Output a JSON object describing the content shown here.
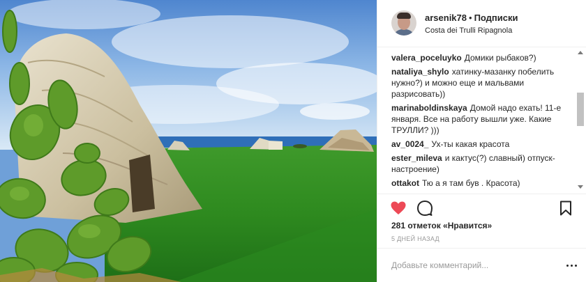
{
  "header": {
    "username": "arsenik78",
    "separator": "•",
    "follow_state": "Подписки",
    "location": "Costa dei Trulli Ripagnola",
    "avatar_icon": "user-avatar-icon"
  },
  "comments": [
    {
      "user": "valera_poceluyko",
      "text": "Домики рыбаков?)"
    },
    {
      "user": "nataliya_shylo",
      "text": "хатинку-мазанку побелить нужно?) и можно еще и мальвами разрисовать))"
    },
    {
      "user": "marinaboldinskaya",
      "text": "Домой надо ехать! 11-е января. Все на работу вышли уже. Какие ТРУЛЛИ? )))"
    },
    {
      "user": "av_0024_",
      "text": "Ух-ты какая красота"
    },
    {
      "user": "ester_mileva",
      "text": "и кактус(?) славный) отпуск-настроение)"
    },
    {
      "user": "ottakot",
      "text": "Тю а я там був . Красота)"
    }
  ],
  "actions": {
    "like_icon": "heart-filled-icon",
    "comment_icon": "comment-bubble-icon",
    "save_icon": "bookmark-icon",
    "like_color": "#ed4956"
  },
  "likes": {
    "text": "281 отметок «Нравится»"
  },
  "timestamp": "5 дней назад",
  "add_comment": {
    "placeholder": "Добавьте комментарий...",
    "more_icon": "more-dots-icon"
  },
  "colors": {
    "text": "#262626",
    "muted": "#999999",
    "border": "#efefef"
  }
}
